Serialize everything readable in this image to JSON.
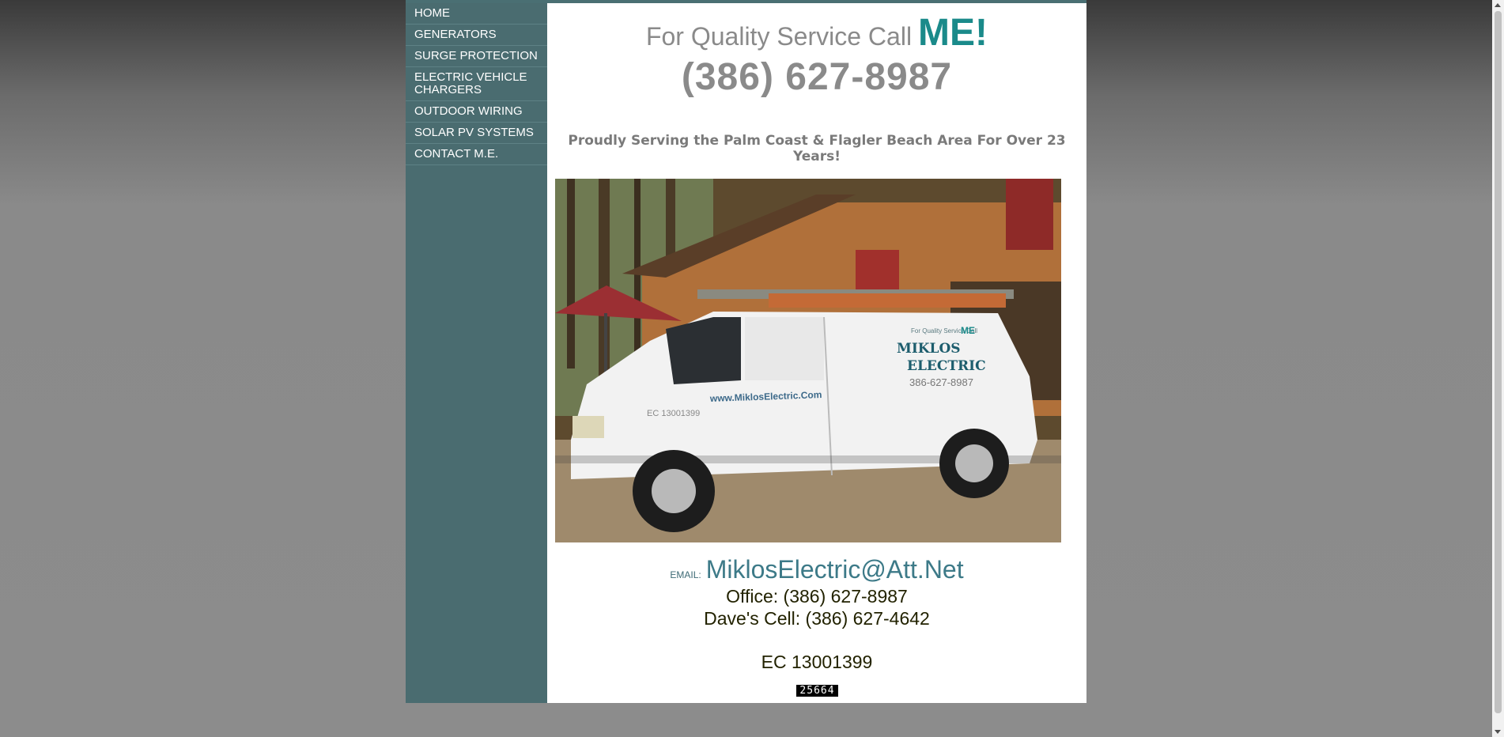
{
  "nav": {
    "items": [
      {
        "label": "HOME"
      },
      {
        "label": "GENERATORS"
      },
      {
        "label": "SURGE PROTECTION"
      },
      {
        "label": "ELECTRIC VEHICLE CHARGERS"
      },
      {
        "label": "OUTDOOR WIRING"
      },
      {
        "label": "SOLAR PV SYSTEMS"
      },
      {
        "label": "CONTACT M.E."
      }
    ]
  },
  "header": {
    "lead": "For Quality Service Call",
    "emphasis": "ME!",
    "phone": "(386) 627-8987",
    "tagline": "Proudly Serving the Palm Coast & Flagler Beach Area For Over 23 Years!"
  },
  "photo": {
    "van_tagline": "For Quality Service Call",
    "van_me": "ME",
    "van_name_1": "MIKLOS",
    "van_name_2": "ELECTRIC",
    "van_phone": "386-627-8987",
    "van_url": "www.MiklosElectric.Com",
    "van_license": "EC 13001399"
  },
  "contact": {
    "email_label": "EMAIL:",
    "email": "MiklosElectric@Att.Net",
    "office": "Office: (386) 627-8987",
    "cell": "Dave's Cell: (386) 627-4642",
    "license": "EC 13001399",
    "hit_counter": "25664"
  },
  "colors": {
    "sidebar": "#4a6c70",
    "accent_teal": "#1a8a8a",
    "grey_text": "#8a8a8a"
  }
}
